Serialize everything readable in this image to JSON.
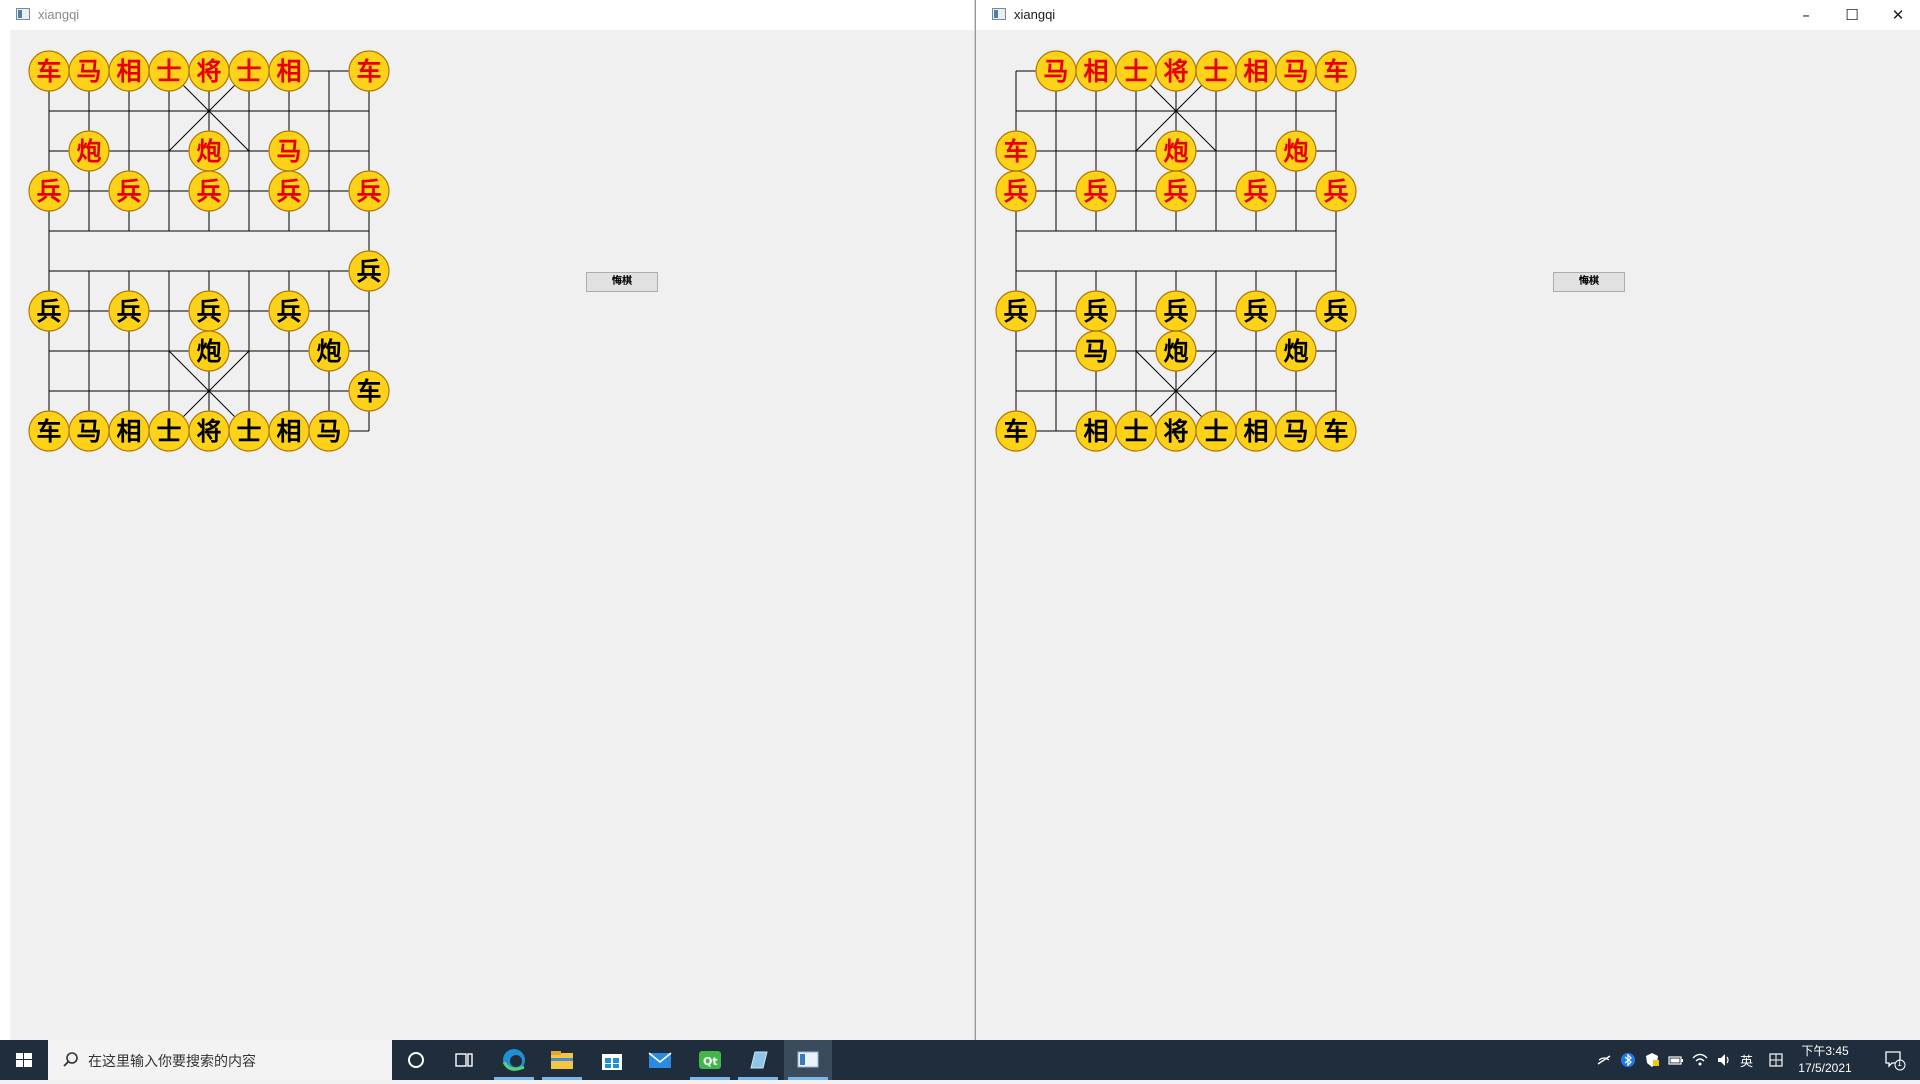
{
  "windows": [
    {
      "title": "xiangqi",
      "undo_label": "悔棋",
      "pieces": [
        {
          "side": "red",
          "label": "车",
          "col": 0,
          "row": 0
        },
        {
          "side": "red",
          "label": "马",
          "col": 1,
          "row": 0
        },
        {
          "side": "red",
          "label": "相",
          "col": 2,
          "row": 0
        },
        {
          "side": "red",
          "label": "士",
          "col": 3,
          "row": 0
        },
        {
          "side": "red",
          "label": "将",
          "col": 4,
          "row": 0
        },
        {
          "side": "red",
          "label": "士",
          "col": 5,
          "row": 0
        },
        {
          "side": "red",
          "label": "相",
          "col": 6,
          "row": 0
        },
        {
          "side": "red",
          "label": "车",
          "col": 8,
          "row": 0
        },
        {
          "side": "red",
          "label": "炮",
          "col": 1,
          "row": 2
        },
        {
          "side": "red",
          "label": "炮",
          "col": 4,
          "row": 2
        },
        {
          "side": "red",
          "label": "马",
          "col": 6,
          "row": 2
        },
        {
          "side": "red",
          "label": "兵",
          "col": 0,
          "row": 3
        },
        {
          "side": "red",
          "label": "兵",
          "col": 2,
          "row": 3
        },
        {
          "side": "red",
          "label": "兵",
          "col": 4,
          "row": 3
        },
        {
          "side": "red",
          "label": "兵",
          "col": 6,
          "row": 3
        },
        {
          "side": "red",
          "label": "兵",
          "col": 8,
          "row": 3
        },
        {
          "side": "black",
          "label": "兵",
          "col": 8,
          "row": 5
        },
        {
          "side": "black",
          "label": "兵",
          "col": 0,
          "row": 6
        },
        {
          "side": "black",
          "label": "兵",
          "col": 2,
          "row": 6
        },
        {
          "side": "black",
          "label": "兵",
          "col": 4,
          "row": 6
        },
        {
          "side": "black",
          "label": "兵",
          "col": 6,
          "row": 6
        },
        {
          "side": "black",
          "label": "炮",
          "col": 4,
          "row": 7
        },
        {
          "side": "black",
          "label": "炮",
          "col": 7,
          "row": 7
        },
        {
          "side": "black",
          "label": "车",
          "col": 8,
          "row": 8
        },
        {
          "side": "black",
          "label": "车",
          "col": 0,
          "row": 9
        },
        {
          "side": "black",
          "label": "马",
          "col": 1,
          "row": 9
        },
        {
          "side": "black",
          "label": "相",
          "col": 2,
          "row": 9
        },
        {
          "side": "black",
          "label": "士",
          "col": 3,
          "row": 9
        },
        {
          "side": "black",
          "label": "将",
          "col": 4,
          "row": 9
        },
        {
          "side": "black",
          "label": "士",
          "col": 5,
          "row": 9
        },
        {
          "side": "black",
          "label": "相",
          "col": 6,
          "row": 9
        },
        {
          "side": "black",
          "label": "马",
          "col": 7,
          "row": 9
        }
      ]
    },
    {
      "title": "xiangqi",
      "undo_label": "悔棋",
      "controls": {
        "minimize": "–",
        "maximize": "☐",
        "close": "✕"
      },
      "pieces": [
        {
          "side": "red",
          "label": "马",
          "col": 1,
          "row": 0
        },
        {
          "side": "red",
          "label": "相",
          "col": 2,
          "row": 0
        },
        {
          "side": "red",
          "label": "士",
          "col": 3,
          "row": 0
        },
        {
          "side": "red",
          "label": "将",
          "col": 4,
          "row": 0
        },
        {
          "side": "red",
          "label": "士",
          "col": 5,
          "row": 0
        },
        {
          "side": "red",
          "label": "相",
          "col": 6,
          "row": 0
        },
        {
          "side": "red",
          "label": "马",
          "col": 7,
          "row": 0
        },
        {
          "side": "red",
          "label": "车",
          "col": 8,
          "row": 0
        },
        {
          "side": "red",
          "label": "车",
          "col": 0,
          "row": 2
        },
        {
          "side": "red",
          "label": "炮",
          "col": 4,
          "row": 2
        },
        {
          "side": "red",
          "label": "炮",
          "col": 7,
          "row": 2
        },
        {
          "side": "red",
          "label": "兵",
          "col": 0,
          "row": 3
        },
        {
          "side": "red",
          "label": "兵",
          "col": 2,
          "row": 3
        },
        {
          "side": "red",
          "label": "兵",
          "col": 4,
          "row": 3
        },
        {
          "side": "red",
          "label": "兵",
          "col": 6,
          "row": 3
        },
        {
          "side": "red",
          "label": "兵",
          "col": 8,
          "row": 3
        },
        {
          "side": "black",
          "label": "兵",
          "col": 0,
          "row": 6
        },
        {
          "side": "black",
          "label": "兵",
          "col": 2,
          "row": 6
        },
        {
          "side": "black",
          "label": "兵",
          "col": 4,
          "row": 6
        },
        {
          "side": "black",
          "label": "兵",
          "col": 6,
          "row": 6
        },
        {
          "side": "black",
          "label": "兵",
          "col": 8,
          "row": 6
        },
        {
          "side": "black",
          "label": "马",
          "col": 2,
          "row": 7
        },
        {
          "side": "black",
          "label": "炮",
          "col": 4,
          "row": 7
        },
        {
          "side": "black",
          "label": "炮",
          "col": 7,
          "row": 7
        },
        {
          "side": "black",
          "label": "车",
          "col": 0,
          "row": 9
        },
        {
          "side": "black",
          "label": "相",
          "col": 2,
          "row": 9
        },
        {
          "side": "black",
          "label": "士",
          "col": 3,
          "row": 9
        },
        {
          "side": "black",
          "label": "将",
          "col": 4,
          "row": 9
        },
        {
          "side": "black",
          "label": "士",
          "col": 5,
          "row": 9
        },
        {
          "side": "black",
          "label": "相",
          "col": 6,
          "row": 9
        },
        {
          "side": "black",
          "label": "马",
          "col": 7,
          "row": 9
        },
        {
          "side": "black",
          "label": "车",
          "col": 8,
          "row": 9
        }
      ]
    }
  ],
  "colors": {
    "piece_fill": "#ffd21a",
    "piece_border": "#b07a00",
    "red_text": "#e60000",
    "black_text": "#000000",
    "board_line": "#000000"
  },
  "taskbar": {
    "search_placeholder": "在这里输入你要搜索的内容",
    "apps": [
      "cortana-icon",
      "task-view-icon",
      "edge-icon",
      "file-explorer-icon",
      "store-icon",
      "mail-icon",
      "qt-creator-icon",
      "notepad-icon",
      "xiangqi-app-icon"
    ],
    "input_method": "英",
    "time": "下午3:45",
    "date": "17/5/2021",
    "notification_count": "1"
  }
}
